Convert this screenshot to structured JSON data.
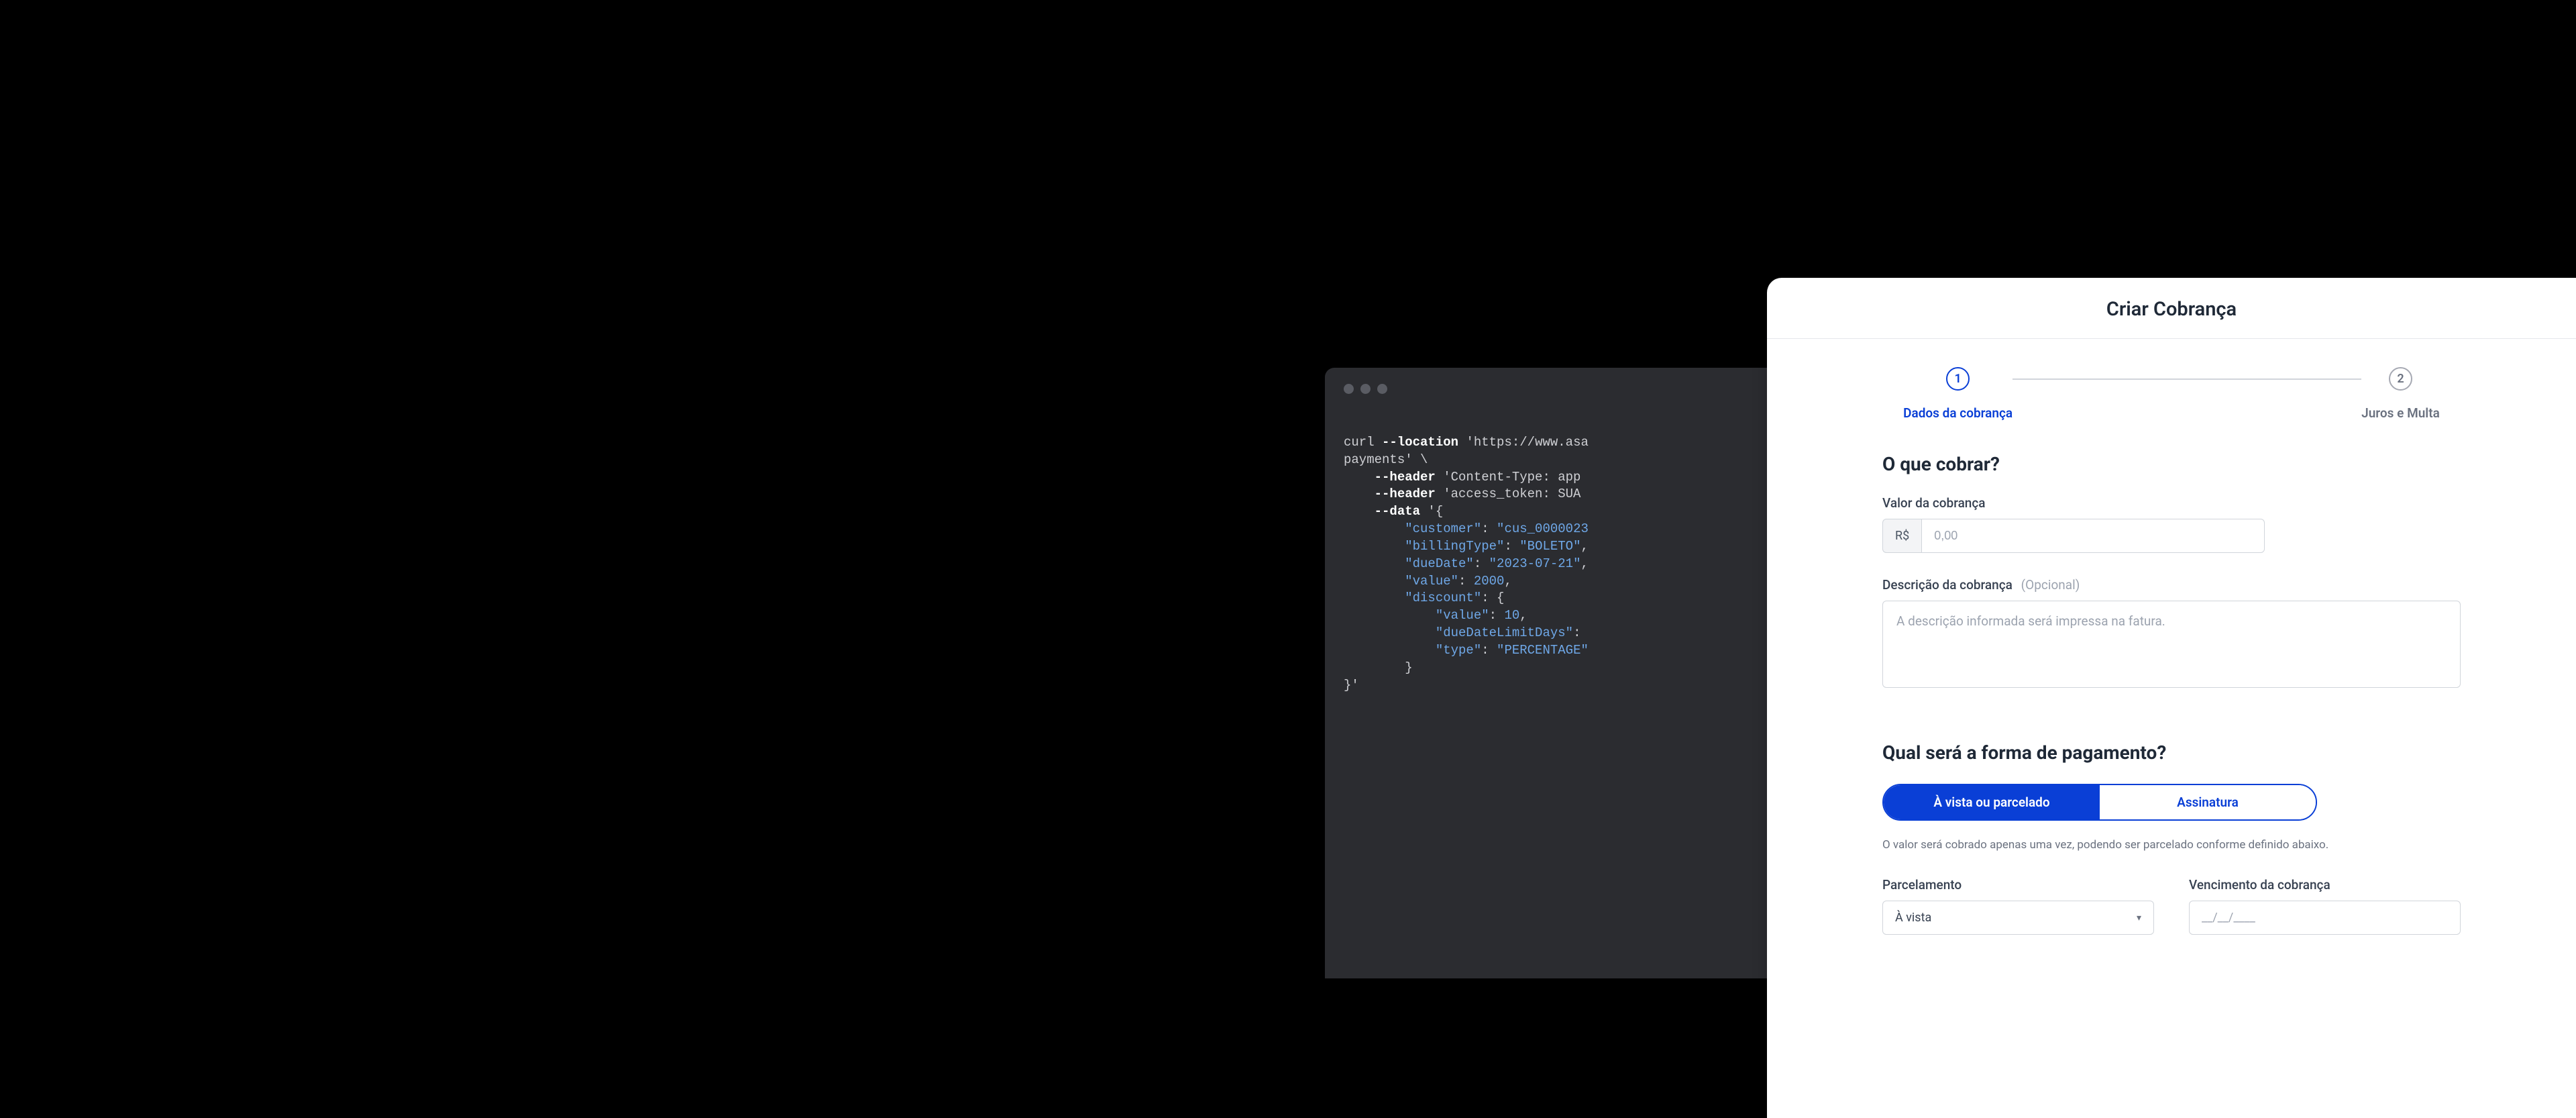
{
  "terminal": {
    "line1_pre": "curl ",
    "line1_flag": "--location",
    "line1_post": " 'https://www.asa",
    "line2": "payments' \\",
    "line3_flag": "    --header",
    "line3_post": " 'Content-Type: app",
    "line4_flag": "    --header",
    "line4_post": " 'access_token: SUA",
    "line5_flag": "    --data",
    "line5_post": " '{",
    "line6_key": "        \"customer\"",
    "line6_sep": ": ",
    "line6_val": "\"cus_0000023",
    "line7_key": "        \"billingType\"",
    "line7_sep": ": ",
    "line7_val": "\"BOLETO\"",
    "line7_end": ",",
    "line8_key": "        \"dueDate\"",
    "line8_sep": ": ",
    "line8_val": "\"2023-07-21\"",
    "line8_end": ",",
    "line9_key": "        \"value\"",
    "line9_sep": ": ",
    "line9_val": "2000",
    "line9_end": ",",
    "line10_key": "        \"discount\"",
    "line10_post": ": {",
    "line11_key": "            \"value\"",
    "line11_sep": ": ",
    "line11_val": "10",
    "line11_end": ",",
    "line12_key": "            \"dueDateLimitDays\"",
    "line12_post": ": ",
    "line13_key": "            \"type\"",
    "line13_sep": ": ",
    "line13_val": "\"PERCENTAGE\"",
    "line14": "        }",
    "line15": "}'"
  },
  "panel": {
    "title": "Criar Cobrança",
    "steps": [
      {
        "num": "1",
        "label": "Dados da cobrança"
      },
      {
        "num": "2",
        "label": "Juros e Multa"
      }
    ],
    "section1_title": "O que cobrar?",
    "valor_label": "Valor da cobrança",
    "valor_prefix": "R$",
    "valor_placeholder": "0,00",
    "descricao_label": "Descrição da cobrança",
    "descricao_optional": "(Opcional)",
    "descricao_placeholder": "A descrição informada será impressa na fatura.",
    "section2_title": "Qual será a forma de pagamento?",
    "toggle_option_a": "À vista ou parcelado",
    "toggle_option_b": "Assinatura",
    "helper": "O valor será cobrado apenas uma vez, podendo ser parcelado conforme definido abaixo.",
    "parcelamento_label": "Parcelamento",
    "parcelamento_value": "À vista",
    "vencimento_label": "Vencimento da cobrança",
    "vencimento_placeholder": "__/__/____"
  }
}
